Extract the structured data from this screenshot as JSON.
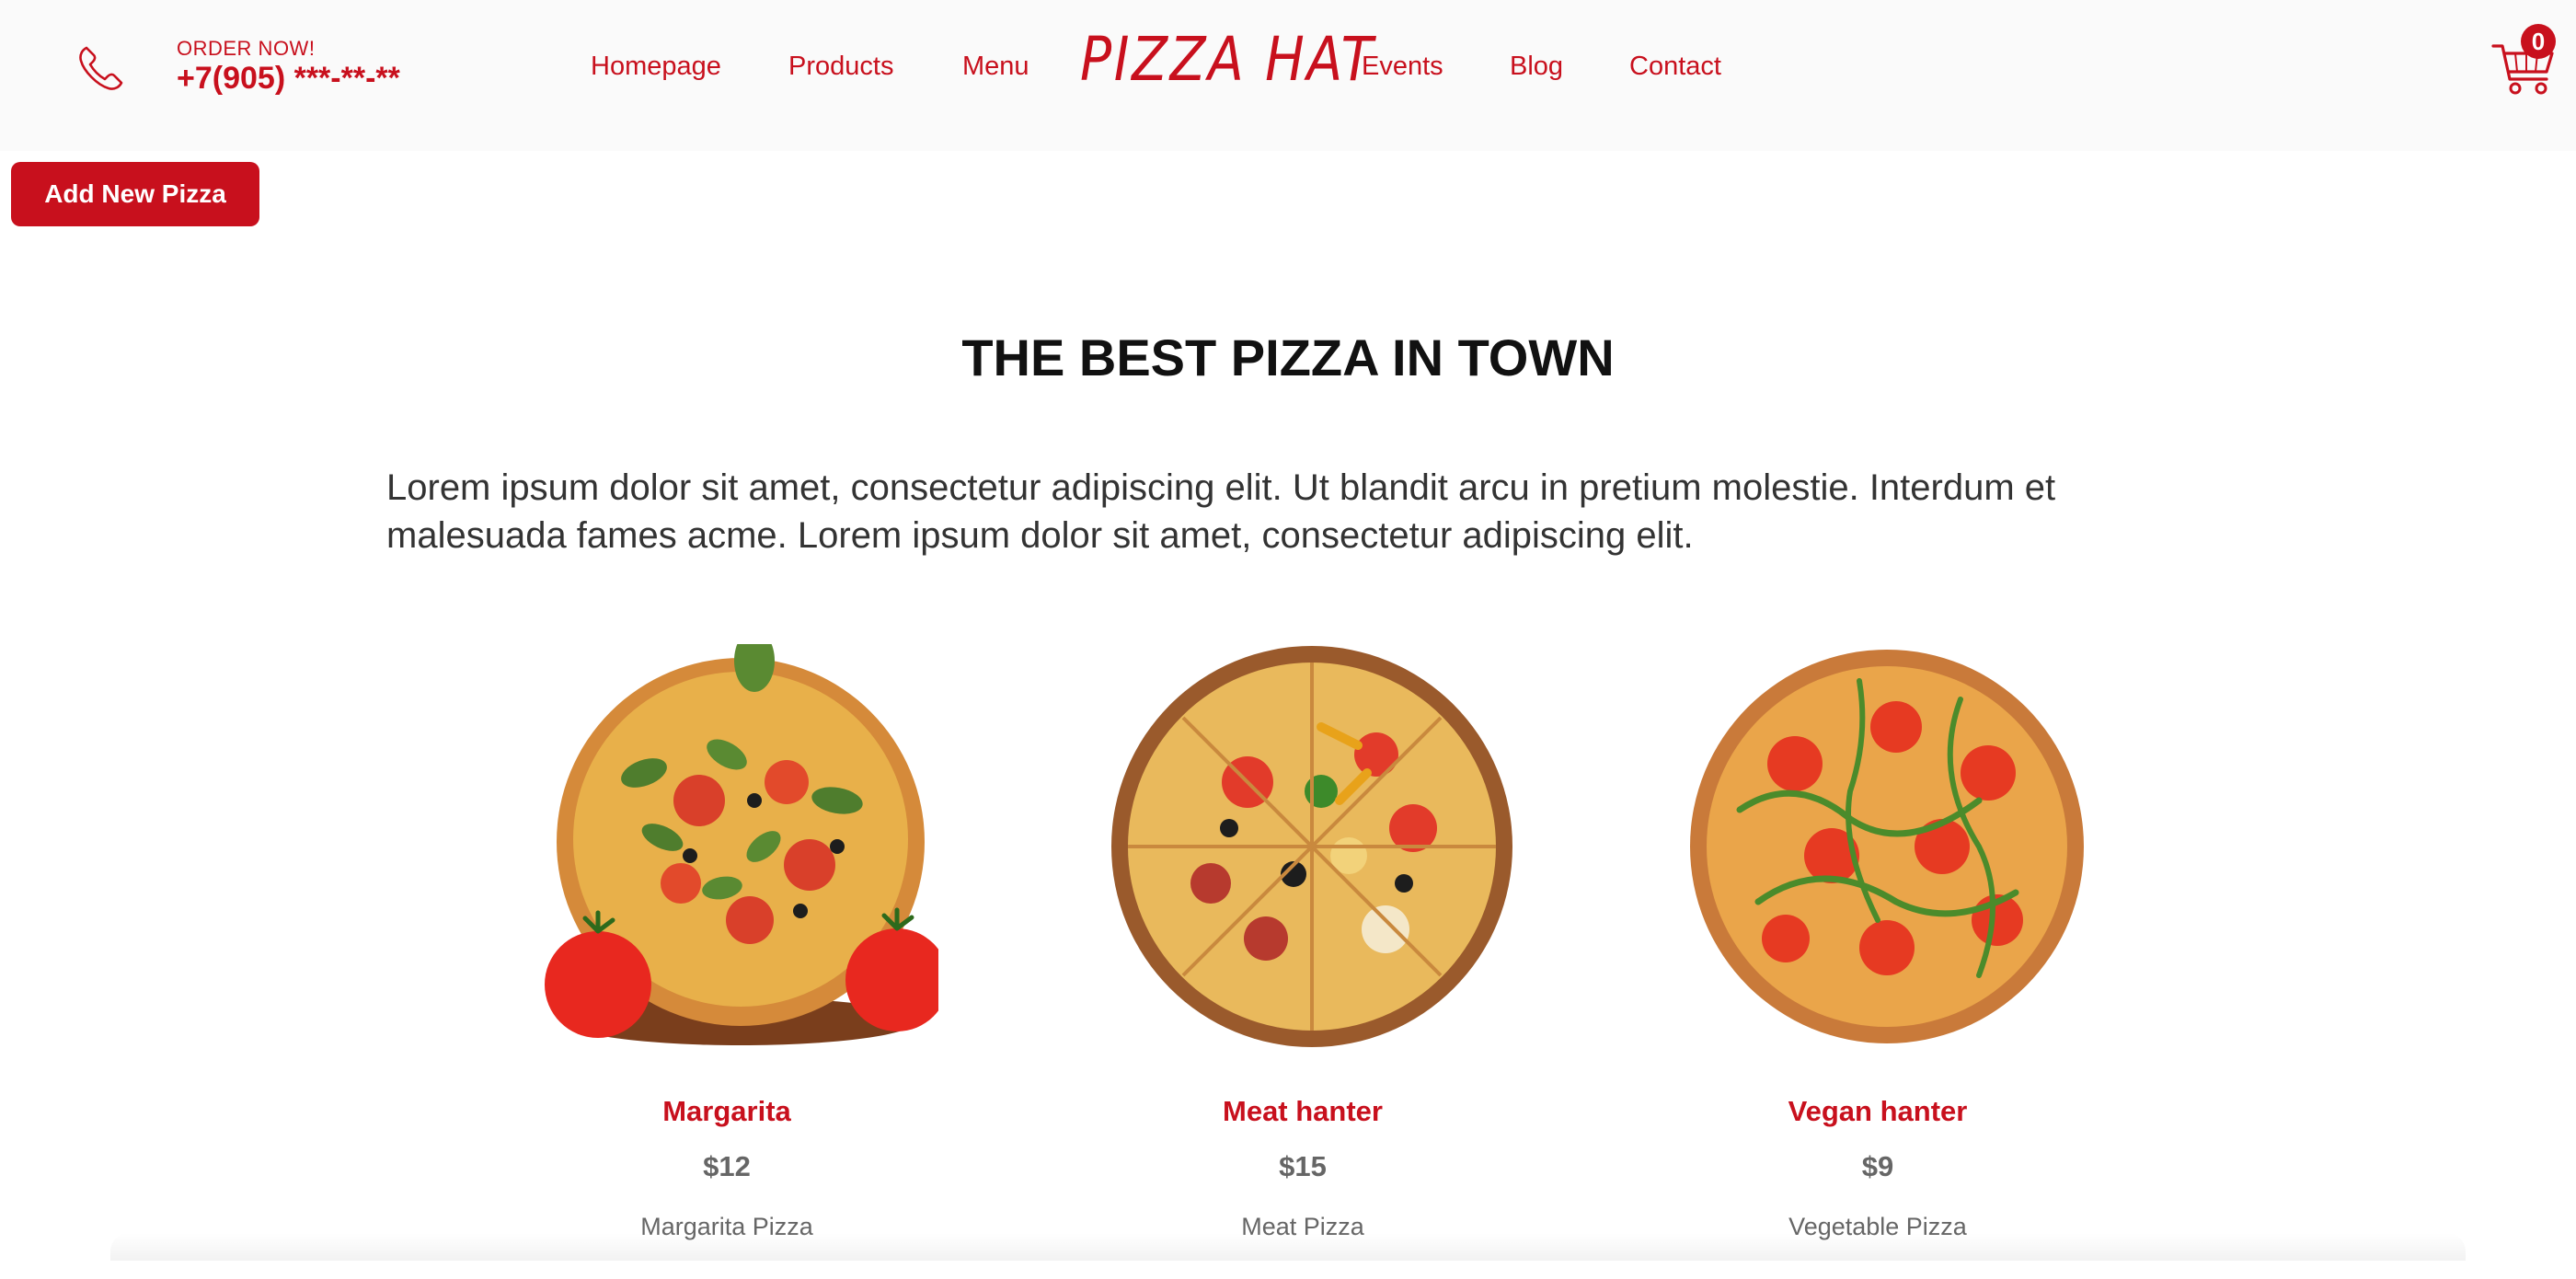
{
  "header": {
    "order_label": "ORDER NOW!",
    "phone": "+7(905) ***-**-**",
    "nav": [
      "Homepage",
      "Products",
      "Menu",
      "Events",
      "Blog",
      "Contact"
    ],
    "logo": "PIZZA HAT",
    "cart_count": "0",
    "icons": {
      "phone": "phone-icon",
      "cart": "cart-icon"
    }
  },
  "actions": {
    "add_pizza": "Add New Pizza"
  },
  "main": {
    "title": "THE BEST PIZZA IN TOWN",
    "intro": "Lorem ipsum dolor sit amet, consectetur adipiscing elit. Ut blandit arcu in pretium molestie. Interdum et malesuada fames acme. Lorem ipsum dolor sit amet, consectetur adipiscing elit.",
    "products": [
      {
        "name": "Margarita",
        "price": "$12",
        "description": "Margarita Pizza"
      },
      {
        "name": "Meat hanter",
        "price": "$15",
        "description": "Meat Pizza"
      },
      {
        "name": "Vegan hanter",
        "price": "$9",
        "description": "Vegetable Pizza"
      }
    ]
  },
  "colors": {
    "accent": "#c8101d",
    "text": "#111111",
    "muted": "#666666",
    "header_bg": "#fafafa"
  }
}
